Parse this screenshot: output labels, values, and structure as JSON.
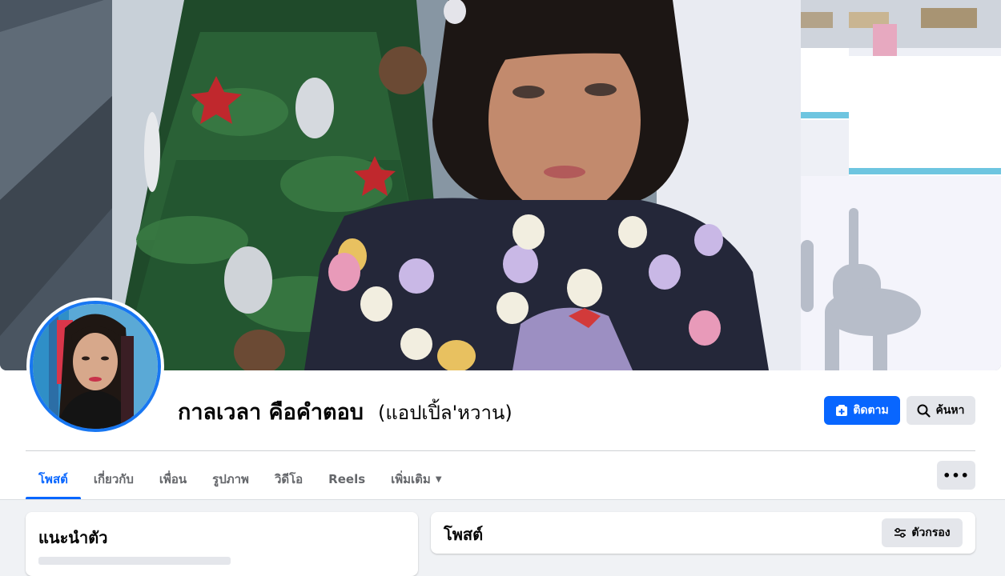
{
  "profile": {
    "name": "กาลเวลา คือคำตอบ",
    "alternate_name": "(แอปเปิ้ล'หวาน)"
  },
  "actions": {
    "follow_label": "ติดตาม",
    "search_label": "ค้นหา",
    "follow_icon": "follow-icon",
    "search_icon": "search-icon"
  },
  "tabs": [
    {
      "label": "โพสต์",
      "active": true
    },
    {
      "label": "เกี่ยวกับ",
      "active": false
    },
    {
      "label": "เพื่อน",
      "active": false
    },
    {
      "label": "รูปภาพ",
      "active": false
    },
    {
      "label": "วิดีโอ",
      "active": false
    },
    {
      "label": "Reels",
      "active": false
    },
    {
      "label": "เพิ่มเติม",
      "active": false,
      "icon": "caret-down-icon"
    }
  ],
  "more_menu_icon": "ellipsis-icon",
  "intro": {
    "title": "แนะนำตัว"
  },
  "posts": {
    "title": "โพสต์",
    "filter_label": "ตัวกรอง",
    "filter_icon": "filter-icon"
  },
  "colors": {
    "accent": "#0866ff",
    "ring": "#1877f2",
    "button_gray": "#e4e6eb",
    "background": "#f0f2f5"
  }
}
